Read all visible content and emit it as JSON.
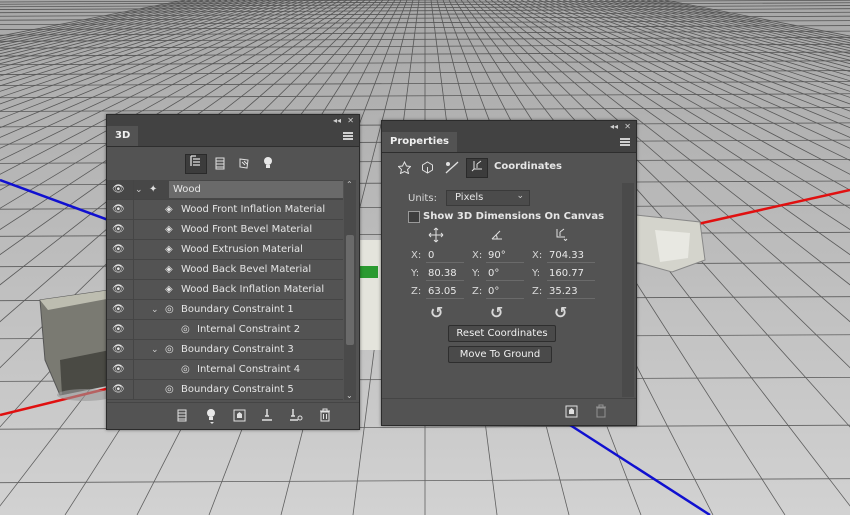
{
  "panel3d": {
    "title": "3D",
    "layers": [
      {
        "label": "Wood",
        "expanded": true,
        "indent": 0
      },
      {
        "label": "Wood Front Inflation Material",
        "indent": 1
      },
      {
        "label": "Wood Front Bevel Material",
        "indent": 1
      },
      {
        "label": "Wood Extrusion Material",
        "indent": 1
      },
      {
        "label": "Wood Back Bevel Material",
        "indent": 1
      },
      {
        "label": "Wood Back Inflation Material",
        "indent": 1
      },
      {
        "label": "Boundary Constraint 1",
        "indent": 1
      },
      {
        "label": "Internal Constraint 2",
        "indent": 2
      },
      {
        "label": "Boundary Constraint 3",
        "indent": 1
      },
      {
        "label": "Internal Constraint 4",
        "indent": 2
      },
      {
        "label": "Boundary Constraint 5",
        "indent": 1
      }
    ],
    "filter_icons": [
      "scene-filter-icon",
      "mesh-filter-icon",
      "material-filter-icon",
      "light-filter-icon"
    ],
    "bottom_icons": [
      "new-mesh-icon",
      "new-light-icon",
      "render-icon",
      "ground-icon",
      "drop-to-plane-icon",
      "delete-icon"
    ]
  },
  "properties": {
    "title": "Properties",
    "section": "Coordinates",
    "units_label": "Units:",
    "units_value": "Pixels",
    "show_dims_label": "Show 3D Dimensions On Canvas",
    "position": {
      "x": "0",
      "y": "80.38",
      "z": "63.05"
    },
    "rotation": {
      "x": "90°",
      "y": "0°",
      "z": "0°"
    },
    "scale": {
      "x": "704.33",
      "y": "160.77",
      "z": "35.23"
    },
    "axis_labels": {
      "x": "X:",
      "y": "Y:",
      "z": "Z:"
    },
    "reset_label": "Reset Coordinates",
    "ground_label": "Move To Ground"
  }
}
